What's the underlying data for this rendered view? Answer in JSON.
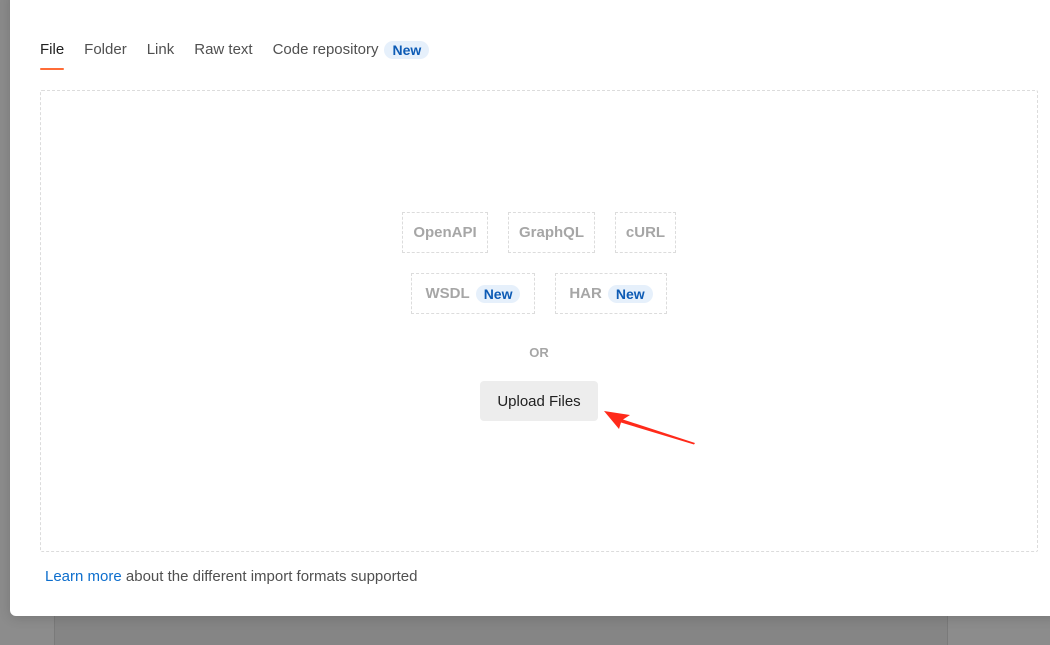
{
  "tabs": [
    {
      "label": "File",
      "active": true
    },
    {
      "label": "Folder",
      "active": false
    },
    {
      "label": "Link",
      "active": false
    },
    {
      "label": "Raw text",
      "active": false
    },
    {
      "label": "Code repository",
      "active": false,
      "badge": "New"
    }
  ],
  "formats": [
    {
      "label": "OpenAPI"
    },
    {
      "label": "GraphQL"
    },
    {
      "label": "cURL"
    },
    {
      "label": "WSDL",
      "badge": "New"
    },
    {
      "label": "HAR",
      "badge": "New"
    }
  ],
  "or_label": "OR",
  "upload_button": "Upload Files",
  "footer": {
    "link_text": "Learn more",
    "text": " about the different import formats supported"
  },
  "colors": {
    "accent": "#ff6c37",
    "badge_bg": "#e6f0fb",
    "badge_text": "#0d5bb5",
    "link": "#0d6ecd",
    "annotation_arrow": "#ff2a1a"
  }
}
